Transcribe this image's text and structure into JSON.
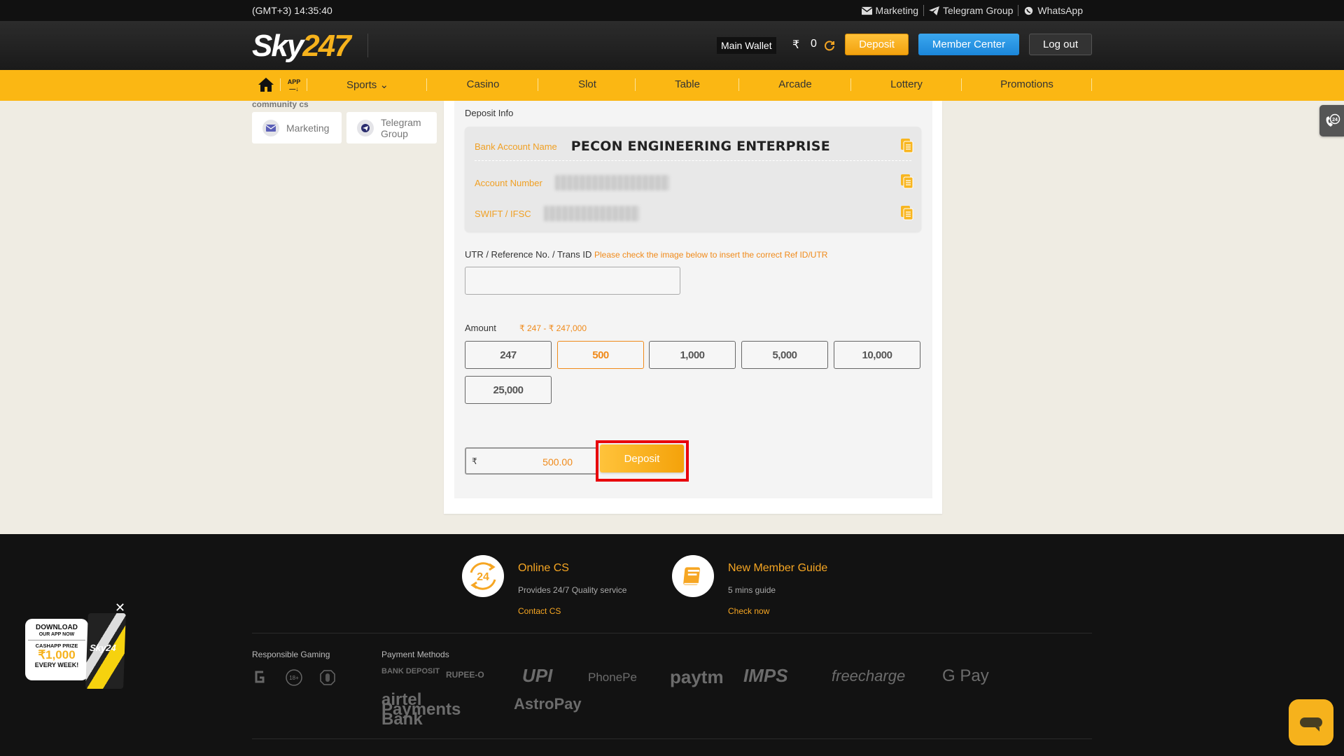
{
  "topbar": {
    "time": "(GMT+3) 14:35:40",
    "links": [
      {
        "icon": "mail-icon",
        "label": "Marketing"
      },
      {
        "icon": "telegram-icon",
        "label": "Telegram Group"
      },
      {
        "icon": "whatsapp-icon",
        "label": "WhatsApp"
      }
    ]
  },
  "header": {
    "logo_part1": "Sky",
    "logo_part2": "247",
    "wallet_label": "Main Wallet",
    "currency": "₹",
    "balance": "0",
    "deposit_label": "Deposit",
    "member_center_label": "Member Center",
    "logout_label": "Log out"
  },
  "nav": {
    "app_label": "APP",
    "items": [
      {
        "label": "Sports ⌄"
      },
      {
        "label": "Casino"
      },
      {
        "label": "Slot"
      },
      {
        "label": "Table"
      },
      {
        "label": "Arcade"
      },
      {
        "label": "Lottery"
      },
      {
        "label": "Promotions"
      }
    ]
  },
  "sidebar": {
    "community_label": "community cs",
    "cards": [
      {
        "icon": "mail-icon",
        "label": "Marketing"
      },
      {
        "icon": "telegram-icon",
        "label": "Telegram Group"
      }
    ]
  },
  "deposit": {
    "section_title": "Deposit Info",
    "bank": {
      "name_label": "Bank Account Name",
      "name_value": "PECON ENGINEERING ENTERPRISE",
      "account_label": "Account Number",
      "account_value": "[blurred]",
      "swift_label": "SWIFT / IFSC",
      "swift_value": "[blurred]"
    },
    "utr_label": "UTR / Reference No. / Trans ID",
    "utr_hint": "Please check the image below to insert the correct Ref ID/UTR",
    "utr_value": "",
    "amount_label": "Amount",
    "amount_range": "₹ 247 - ₹ 247,000",
    "amount_options": [
      "247",
      "500",
      "1,000",
      "5,000",
      "10,000",
      "25,000"
    ],
    "selected_amount": "500",
    "final_currency": "₹",
    "final_amount": "500.00",
    "submit_label": "Deposit"
  },
  "footer": {
    "online_cs": {
      "title": "Online CS",
      "subtitle": "Provides 24/7 Quality service",
      "link": "Contact CS",
      "badge": "24"
    },
    "guide": {
      "title": "New Member Guide",
      "subtitle": "5 mins guide",
      "link": "Check now"
    },
    "responsible_gaming_label": "Responsible Gaming",
    "responsible_icons": [
      "gamcare-icon",
      "age-18-plus-icon",
      "hand-stop-icon"
    ],
    "age_badge": "18+",
    "payment_methods_label": "Payment Methods",
    "payment_methods": [
      "BANK DEPOSIT",
      "RUPEE-O",
      "UPI",
      "PhonePe",
      "paytm",
      "IMPS",
      "freecharge",
      "G Pay",
      "airtel Payments Bank",
      "AstroPay"
    ]
  },
  "promo": {
    "line1": "DOWNLOAD",
    "line2": "OUR APP NOW",
    "line3": "CASHAPP PRIZE",
    "line4": "₹1,000",
    "line5": "EVERY WEEK!",
    "phone_brand": "Sky24",
    "close": "✕"
  },
  "colors": {
    "brand_yellow": "#fbb713",
    "accent_orange": "#f08a1a",
    "member_blue": "#2196e6",
    "highlight_red": "#e8000b"
  }
}
